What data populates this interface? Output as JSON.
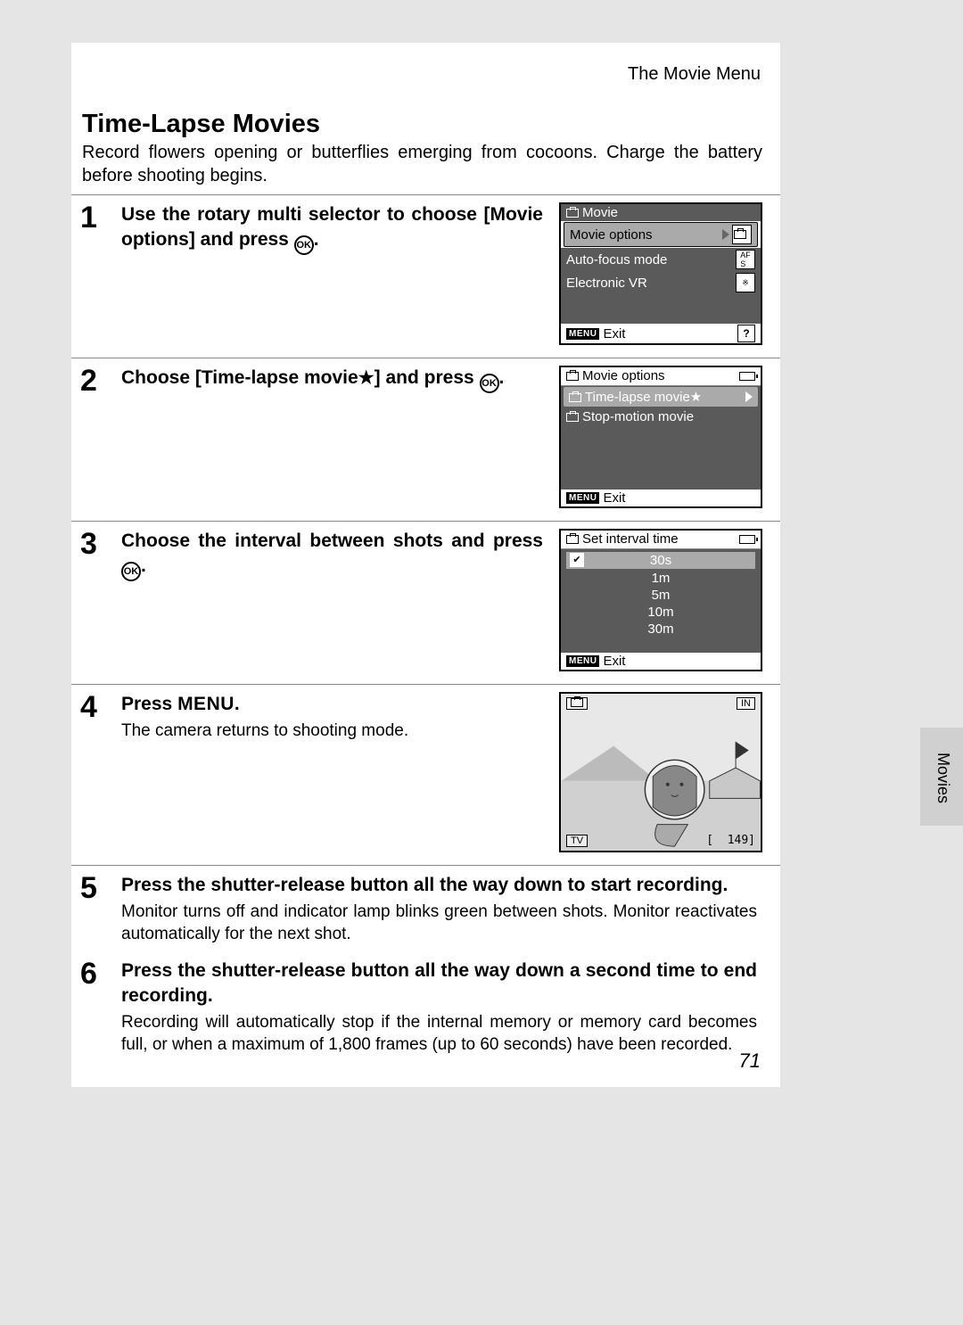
{
  "header": {
    "breadcrumb": "The Movie Menu"
  },
  "title": "Time-Lapse Movies",
  "intro": "Record flowers opening or butterflies emerging from cocoons. Charge the battery before shooting begins.",
  "ok_glyph": "OK",
  "star_glyph": "★",
  "steps": [
    {
      "num": "1",
      "heading_a": "Use the rotary multi selector to choose [Movie options] and press ",
      "heading_b": "."
    },
    {
      "num": "2",
      "heading_a": "Choose [Time-lapse movie",
      "heading_b": "] and press ",
      "heading_c": "."
    },
    {
      "num": "3",
      "heading_a": "Choose the interval between shots and press ",
      "heading_b": "."
    },
    {
      "num": "4",
      "heading_a": "Press ",
      "menu_word": "MENU",
      "heading_b": ".",
      "sub": "The camera returns to shooting mode."
    },
    {
      "num": "5",
      "heading": "Press the shutter-release button all the way down to start recording.",
      "sub": "Monitor turns off and indicator lamp blinks green between shots. Monitor reactivates automatically for the next shot."
    },
    {
      "num": "6",
      "heading": "Press the shutter-release button all the way down a second time to end recording.",
      "sub": "Recording will automatically stop if the internal memory or memory card becomes full, or when a maximum of 1,800 frames (up to 60 seconds) have been recorded."
    }
  ],
  "screen1": {
    "title": "Movie",
    "items": [
      "Movie options",
      "Auto-focus mode",
      "Electronic VR"
    ],
    "footer_menu": "MENU",
    "footer": "Exit",
    "help": "?"
  },
  "screen2": {
    "title": "Movie options",
    "items": [
      "Time-lapse movie★",
      "Stop-motion movie"
    ],
    "footer_menu": "MENU",
    "footer": "Exit"
  },
  "screen3": {
    "title": "Set interval time",
    "items": [
      "30s",
      "1m",
      "5m",
      "10m",
      "30m"
    ],
    "footer_menu": "MENU",
    "footer": "Exit"
  },
  "screen4": {
    "in_label": "IN",
    "tv_label": "TV",
    "count": "149"
  },
  "side_tab": "Movies",
  "page_num": "71"
}
